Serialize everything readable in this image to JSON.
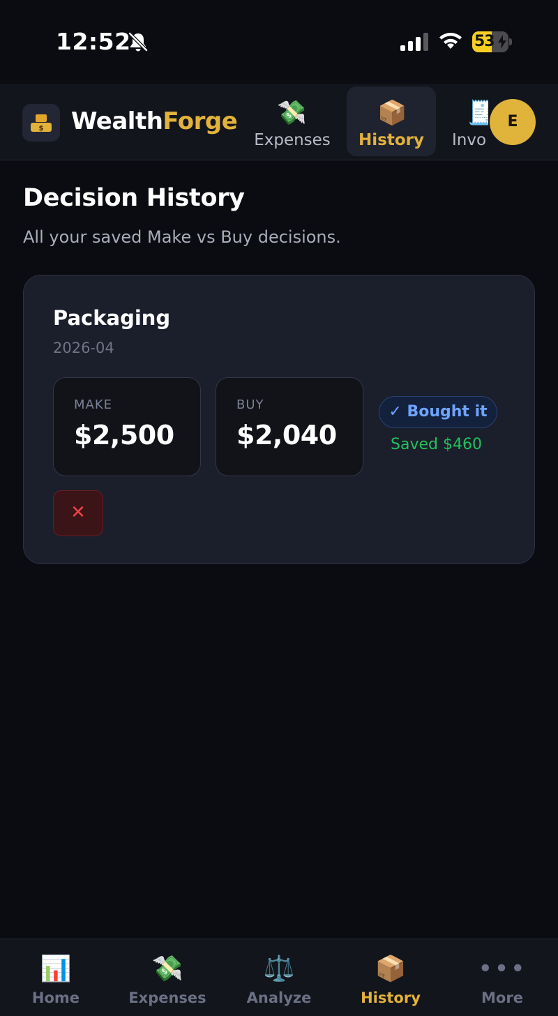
{
  "status_bar": {
    "time": "12:52",
    "battery_percent": "53",
    "battery_level": 0.53,
    "icons": [
      "bell-slash-icon",
      "cellular-signal-icon",
      "wifi-icon",
      "battery-charging-icon"
    ]
  },
  "header": {
    "brand_part1": "Wealth",
    "brand_part2": "Forge",
    "tabs": [
      {
        "label": "Expenses",
        "icon": "💸"
      },
      {
        "label": "History",
        "icon": "📦",
        "active": true
      },
      {
        "label": "Invo",
        "icon": "🧾"
      }
    ],
    "avatar_initial": "E"
  },
  "main": {
    "title": "Decision History",
    "subtitle": "All your saved Make vs Buy decisions.",
    "decisions": [
      {
        "name": "Packaging",
        "date": "2026-04",
        "make_label": "MAKE",
        "make_value": "$2,500",
        "buy_label": "BUY",
        "buy_value": "$2,040",
        "decision_badge": "✓ Bought it",
        "savings": "Saved $460",
        "delete_icon": "✕"
      }
    ]
  },
  "bottom_nav": {
    "items": [
      {
        "label": "Home",
        "icon": "📊"
      },
      {
        "label": "Expenses",
        "icon": "💸"
      },
      {
        "label": "Analyze",
        "icon": "⚖️"
      },
      {
        "label": "History",
        "icon": "📦",
        "active": true
      },
      {
        "label": "More",
        "icon": "•••"
      }
    ]
  },
  "colors": {
    "background": "#0b0c11",
    "accent_gold": "#e2b23b",
    "card": "#1b1e2b",
    "badge_blue": "#6ea4ff",
    "success_green": "#22c05c",
    "danger_red": "#ef4444"
  }
}
